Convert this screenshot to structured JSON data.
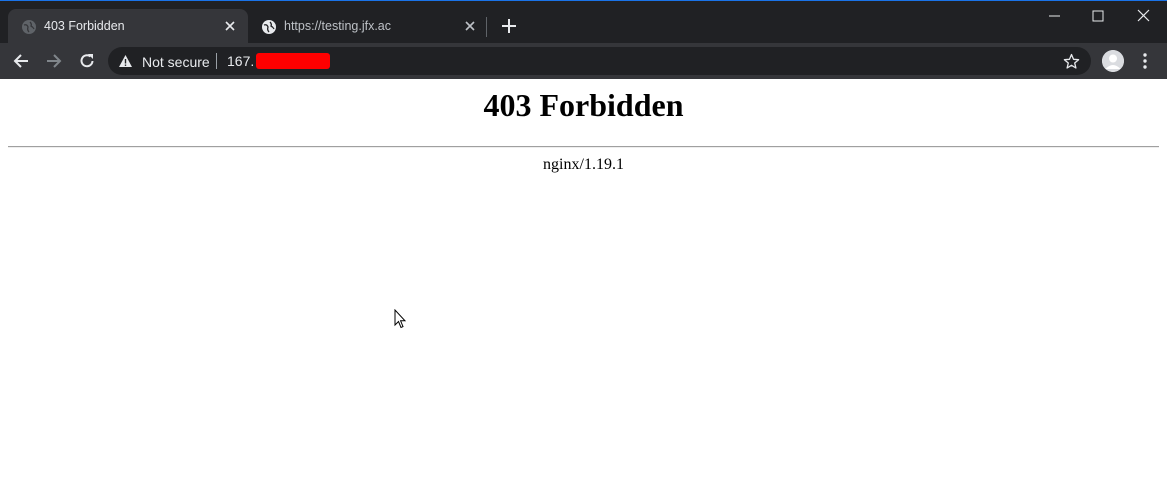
{
  "browser": {
    "tabs": [
      {
        "title": "403 Forbidden",
        "active": true,
        "icon": "globe-icon"
      },
      {
        "title": "https://testing.jfx.ac",
        "active": false,
        "icon": "globe-icon"
      }
    ],
    "address_bar": {
      "security_label": "Not secure",
      "url_visible": "167.",
      "redacted": true
    },
    "colors": {
      "frame": "#202124",
      "toolbar": "#35363a",
      "redaction": "#ff0000"
    }
  },
  "page": {
    "heading": "403 Forbidden",
    "server": "nginx/1.19.1"
  }
}
